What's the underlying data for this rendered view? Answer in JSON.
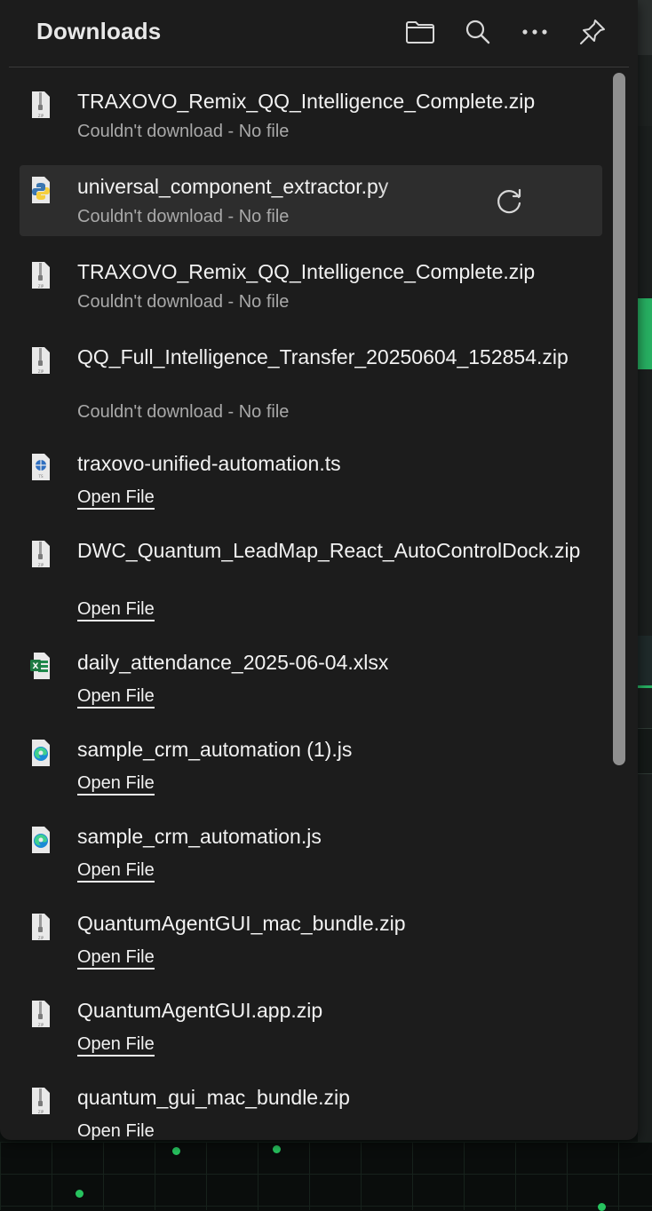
{
  "header": {
    "title": "Downloads",
    "icons": [
      "folder-icon",
      "search-icon",
      "more-icon",
      "pin-icon"
    ]
  },
  "downloads": [
    {
      "name": "TRAXOVO_Remix_QQ_Intelligence_Complete.zip",
      "status": "Couldn't download - No file",
      "icon": "zip-file-icon"
    },
    {
      "name": "universal_component_extractor.py",
      "status": "Couldn't download - No file",
      "icon": "python-file-icon",
      "action": "retry-icon"
    },
    {
      "name": "TRAXOVO_Remix_QQ_Intelligence_Complete.zip",
      "status": "Couldn't download - No file",
      "icon": "zip-file-icon"
    },
    {
      "name": "QQ_Full_Intelligence_Transfer_20250604_152854.zip",
      "status": "Couldn't download - No file",
      "icon": "zip-file-icon"
    },
    {
      "name": "traxovo-unified-automation.ts",
      "link": "Open File",
      "icon": "ts-file-icon"
    },
    {
      "name": "DWC_Quantum_LeadMap_React_AutoControlDock.zip",
      "link": "Open File",
      "icon": "zip-file-icon"
    },
    {
      "name": "daily_attendance_2025-06-04.xlsx",
      "link": "Open File",
      "icon": "excel-file-icon"
    },
    {
      "name": "sample_crm_automation (1).js",
      "link": "Open File",
      "icon": "edge-file-icon"
    },
    {
      "name": "sample_crm_automation.js",
      "link": "Open File",
      "icon": "edge-file-icon"
    },
    {
      "name": "QuantumAgentGUI_mac_bundle.zip",
      "link": "Open File",
      "icon": "zip-file-icon"
    },
    {
      "name": "QuantumAgentGUI.app.zip",
      "link": "Open File",
      "icon": "zip-file-icon"
    },
    {
      "name": "quantum_gui_mac_bundle.zip",
      "link": "Open File",
      "icon": "zip-file-icon"
    }
  ],
  "colors": {
    "panel": "#1c1c1c",
    "hover": "#2d2d2d",
    "text": "#f2f2f2",
    "muted": "#a9a9a9",
    "accent_green": "#27c35f"
  }
}
